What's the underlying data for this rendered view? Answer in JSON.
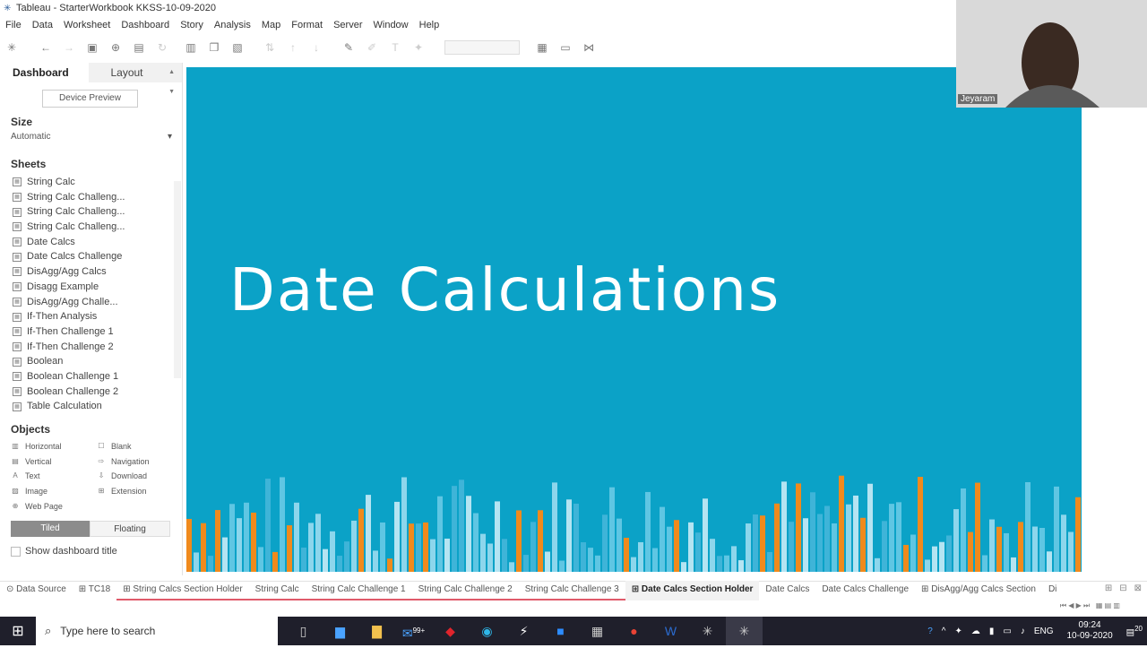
{
  "window": {
    "title": "Tableau - StarterWorkbook KKSS-10-09-2020"
  },
  "menu": [
    "File",
    "Data",
    "Worksheet",
    "Dashboard",
    "Story",
    "Analysis",
    "Map",
    "Format",
    "Server",
    "Window",
    "Help"
  ],
  "left_panel": {
    "tab_dashboard": "Dashboard",
    "tab_layout": "Layout",
    "device_preview": "Device Preview",
    "size_title": "Size",
    "size_value": "Automatic",
    "sheets_title": "Sheets",
    "sheets": [
      "String Calc",
      "String Calc Challeng...",
      "String Calc Challeng...",
      "String Calc Challeng...",
      "Date Calcs",
      "Date Calcs Challenge",
      "DisAgg/Agg Calcs",
      "Disagg Example",
      "DisAgg/Agg Challe...",
      "If-Then Analysis",
      "If-Then Challenge 1",
      "If-Then Challenge 2",
      "Boolean",
      "Boolean Challenge 1",
      "Boolean Challenge 2",
      "Table Calculation"
    ],
    "objects_title": "Objects",
    "objects": [
      {
        "label": "Horizontal",
        "icon": "horizontal-icon"
      },
      {
        "label": "Blank",
        "icon": "blank-icon"
      },
      {
        "label": "Vertical",
        "icon": "vertical-icon"
      },
      {
        "label": "Navigation",
        "icon": "navigation-icon"
      },
      {
        "label": "Text",
        "icon": "text-icon"
      },
      {
        "label": "Download",
        "icon": "download-icon"
      },
      {
        "label": "Image",
        "icon": "image-icon"
      },
      {
        "label": "Extension",
        "icon": "extension-icon"
      },
      {
        "label": "Web Page",
        "icon": "web-page-icon"
      }
    ],
    "tiled": "Tiled",
    "floating": "Floating",
    "show_title": "Show dashboard title"
  },
  "canvas": {
    "headline": "Date Calculations"
  },
  "webcam": {
    "name": "Jeyaram"
  },
  "sheet_tabs": [
    {
      "label": "Data Source",
      "style": ""
    },
    {
      "label": "TC18",
      "style": ""
    },
    {
      "label": "String Calcs Section Holder",
      "style": "red"
    },
    {
      "label": "String Calc",
      "style": "red"
    },
    {
      "label": "String Calc Challenge 1",
      "style": "red"
    },
    {
      "label": "String Calc Challenge 2",
      "style": "red"
    },
    {
      "label": "String Calc Challenge 3",
      "style": "red"
    },
    {
      "label": "Date Calcs Section Holder",
      "style": "active"
    },
    {
      "label": "Date Calcs",
      "style": ""
    },
    {
      "label": "Date Calcs Challenge",
      "style": ""
    },
    {
      "label": "DisAgg/Agg Calcs Section",
      "style": ""
    },
    {
      "label": "Di",
      "style": ""
    }
  ],
  "taskbar": {
    "search_placeholder": "Type here to search",
    "mail_badge": "99+",
    "language": "ENG",
    "time": "09:24",
    "date": "10-09-2020",
    "notifications": "20"
  }
}
